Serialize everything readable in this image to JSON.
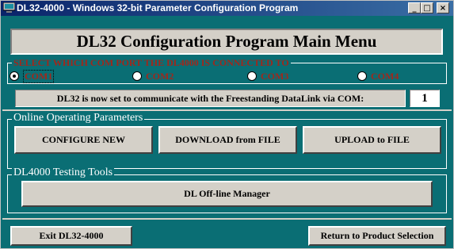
{
  "window": {
    "title": "DL32-4000 - Windows 32-bit Parameter Configuration Program",
    "controls": {
      "minimize": "_",
      "maximize": "□",
      "close": "×"
    }
  },
  "main_title": "DL32 Configuration Program Main Menu",
  "com_section": {
    "label": "SELECT WHICH COM PORT THE DL4000 IS CONNECTED TO",
    "options": [
      "COM1",
      "COM2",
      "COM3",
      "COM4"
    ],
    "selected": "COM1",
    "status_text": "DL32 is now set to communicate with the Freestanding DataLink via COM:",
    "port_value": "1"
  },
  "online": {
    "label": "Online Operating Parameters",
    "configure_new": "CONFIGURE NEW",
    "download": "DOWNLOAD from FILE",
    "upload": "UPLOAD to FILE"
  },
  "testing": {
    "label": "DL4000 Testing Tools",
    "offline_manager": "DL Off-line Manager"
  },
  "footer": {
    "exit": "Exit DL32-4000",
    "return": "Return to Product Selection"
  },
  "colors": {
    "background": "#0a6e74",
    "panel": "#d4d0c8",
    "section_text": "#a0281c"
  }
}
